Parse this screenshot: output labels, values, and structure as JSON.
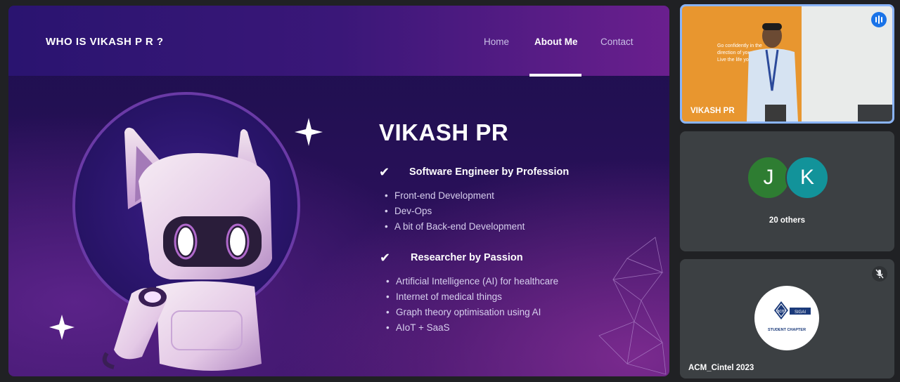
{
  "slide": {
    "brand": "WHO IS VIKASH P R ?",
    "nav": {
      "home": "Home",
      "about": "About Me",
      "contact": "Contact"
    },
    "name": "VIKASH PR",
    "sections": [
      {
        "heading": "Software Engineer by Profession",
        "items": [
          "Front-end Development",
          "Dev-Ops",
          "A bit of Back-end Development"
        ]
      },
      {
        "heading": "Researcher by Passion",
        "items": [
          "Artificial Intelligence (AI) for healthcare",
          "Internet of medical things",
          "Graph theory optimisation using AI",
          "AIoT + SaaS"
        ]
      }
    ],
    "wall_text": [
      "Go confidently in the",
      "direction of your",
      "Live the life you"
    ]
  },
  "participants": {
    "presenter": {
      "name": "VIKASH PR"
    },
    "avatars": [
      {
        "initial": "J",
        "color": "#2e7d32"
      },
      {
        "initial": "K",
        "color": "#12939a"
      }
    ],
    "others_label": "20 others",
    "acm": {
      "name": "ACM_Cintel 2023",
      "logo_text": "acm",
      "logo_sub": "STUDENT CHAPTER",
      "logo_badge": "SIGAI"
    }
  },
  "colors": {
    "speaking_blue": "#1a73e8",
    "tile_bg": "#3c4043",
    "meet_bg": "#202124"
  }
}
